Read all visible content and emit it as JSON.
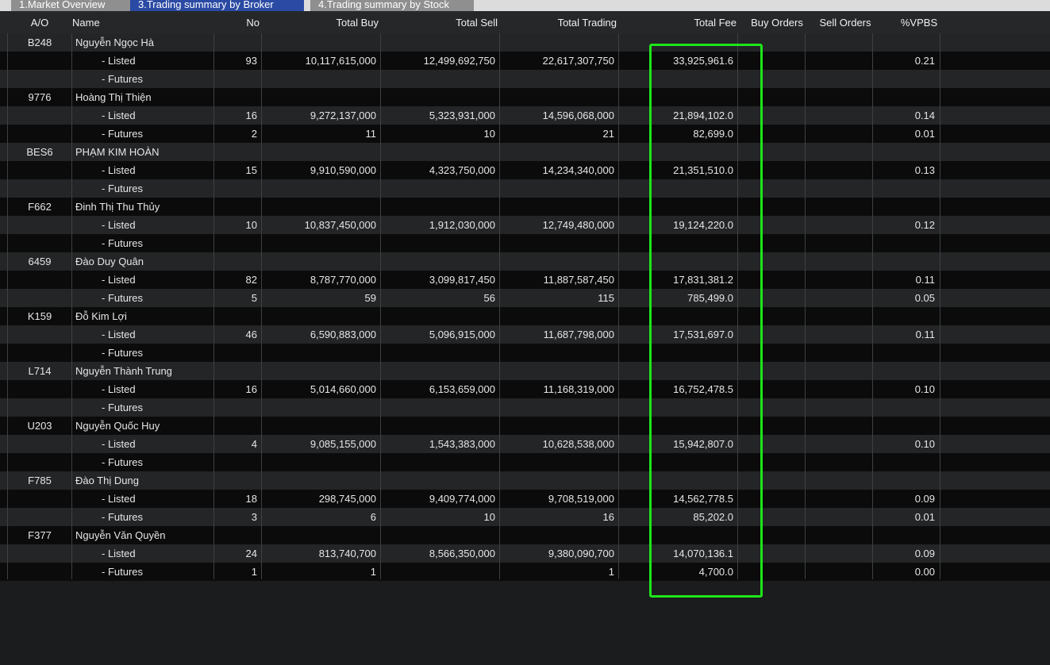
{
  "tabs": [
    {
      "label": "1.Market Overview",
      "active": false
    },
    {
      "label": "3.Trading summary by Broker",
      "active": true
    },
    {
      "label": "4.Trading summary by Stock",
      "active": false
    }
  ],
  "columns": [
    "A/O",
    "Name",
    "No",
    "Total Buy",
    "Total Sell",
    "Total Trading",
    "Total Fee",
    "Buy Orders",
    "Sell Orders",
    "%VPBS"
  ],
  "rows": [
    {
      "ao": "B248",
      "name": "Nguyễn Ngọc Hà",
      "no": "",
      "buy": "",
      "sell": "",
      "trading": "",
      "fee": "",
      "buy_orders": "",
      "sell_orders": "",
      "vpbs": ""
    },
    {
      "ao": "",
      "name": "- Listed",
      "no": "93",
      "buy": "10,117,615,000",
      "sell": "12,499,692,750",
      "trading": "22,617,307,750",
      "fee": "33,925,961.6",
      "buy_orders": "",
      "sell_orders": "",
      "vpbs": "0.21"
    },
    {
      "ao": "",
      "name": "- Futures",
      "no": "",
      "buy": "",
      "sell": "",
      "trading": "",
      "fee": "",
      "buy_orders": "",
      "sell_orders": "",
      "vpbs": ""
    },
    {
      "ao": "9776",
      "name": "Hoàng Thị Thiện",
      "no": "",
      "buy": "",
      "sell": "",
      "trading": "",
      "fee": "",
      "buy_orders": "",
      "sell_orders": "",
      "vpbs": ""
    },
    {
      "ao": "",
      "name": "- Listed",
      "no": "16",
      "buy": "9,272,137,000",
      "sell": "5,323,931,000",
      "trading": "14,596,068,000",
      "fee": "21,894,102.0",
      "buy_orders": "",
      "sell_orders": "",
      "vpbs": "0.14"
    },
    {
      "ao": "",
      "name": "- Futures",
      "no": "2",
      "buy": "11",
      "sell": "10",
      "trading": "21",
      "fee": "82,699.0",
      "buy_orders": "",
      "sell_orders": "",
      "vpbs": "0.01"
    },
    {
      "ao": "BES6",
      "name": "PHẠM KIM HOÀN",
      "no": "",
      "buy": "",
      "sell": "",
      "trading": "",
      "fee": "",
      "buy_orders": "",
      "sell_orders": "",
      "vpbs": ""
    },
    {
      "ao": "",
      "name": "- Listed",
      "no": "15",
      "buy": "9,910,590,000",
      "sell": "4,323,750,000",
      "trading": "14,234,340,000",
      "fee": "21,351,510.0",
      "buy_orders": "",
      "sell_orders": "",
      "vpbs": "0.13"
    },
    {
      "ao": "",
      "name": "- Futures",
      "no": "",
      "buy": "",
      "sell": "",
      "trading": "",
      "fee": "",
      "buy_orders": "",
      "sell_orders": "",
      "vpbs": ""
    },
    {
      "ao": "F662",
      "name": "Đinh Thị Thu Thủy",
      "no": "",
      "buy": "",
      "sell": "",
      "trading": "",
      "fee": "",
      "buy_orders": "",
      "sell_orders": "",
      "vpbs": ""
    },
    {
      "ao": "",
      "name": "- Listed",
      "no": "10",
      "buy": "10,837,450,000",
      "sell": "1,912,030,000",
      "trading": "12,749,480,000",
      "fee": "19,124,220.0",
      "buy_orders": "",
      "sell_orders": "",
      "vpbs": "0.12"
    },
    {
      "ao": "",
      "name": "- Futures",
      "no": "",
      "buy": "",
      "sell": "",
      "trading": "",
      "fee": "",
      "buy_orders": "",
      "sell_orders": "",
      "vpbs": ""
    },
    {
      "ao": "6459",
      "name": "Đào Duy Quân",
      "no": "",
      "buy": "",
      "sell": "",
      "trading": "",
      "fee": "",
      "buy_orders": "",
      "sell_orders": "",
      "vpbs": ""
    },
    {
      "ao": "",
      "name": "- Listed",
      "no": "82",
      "buy": "8,787,770,000",
      "sell": "3,099,817,450",
      "trading": "11,887,587,450",
      "fee": "17,831,381.2",
      "buy_orders": "",
      "sell_orders": "",
      "vpbs": "0.11"
    },
    {
      "ao": "",
      "name": "- Futures",
      "no": "5",
      "buy": "59",
      "sell": "56",
      "trading": "115",
      "fee": "785,499.0",
      "buy_orders": "",
      "sell_orders": "",
      "vpbs": "0.05"
    },
    {
      "ao": "K159",
      "name": "Đỗ Kim Lợi",
      "no": "",
      "buy": "",
      "sell": "",
      "trading": "",
      "fee": "",
      "buy_orders": "",
      "sell_orders": "",
      "vpbs": ""
    },
    {
      "ao": "",
      "name": "- Listed",
      "no": "46",
      "buy": "6,590,883,000",
      "sell": "5,096,915,000",
      "trading": "11,687,798,000",
      "fee": "17,531,697.0",
      "buy_orders": "",
      "sell_orders": "",
      "vpbs": "0.11"
    },
    {
      "ao": "",
      "name": "- Futures",
      "no": "",
      "buy": "",
      "sell": "",
      "trading": "",
      "fee": "",
      "buy_orders": "",
      "sell_orders": "",
      "vpbs": ""
    },
    {
      "ao": "L714",
      "name": "Nguyễn Thành Trung",
      "no": "",
      "buy": "",
      "sell": "",
      "trading": "",
      "fee": "",
      "buy_orders": "",
      "sell_orders": "",
      "vpbs": ""
    },
    {
      "ao": "",
      "name": "- Listed",
      "no": "16",
      "buy": "5,014,660,000",
      "sell": "6,153,659,000",
      "trading": "11,168,319,000",
      "fee": "16,752,478.5",
      "buy_orders": "",
      "sell_orders": "",
      "vpbs": "0.10"
    },
    {
      "ao": "",
      "name": "- Futures",
      "no": "",
      "buy": "",
      "sell": "",
      "trading": "",
      "fee": "",
      "buy_orders": "",
      "sell_orders": "",
      "vpbs": ""
    },
    {
      "ao": "U203",
      "name": "Nguyễn Quốc Huy",
      "no": "",
      "buy": "",
      "sell": "",
      "trading": "",
      "fee": "",
      "buy_orders": "",
      "sell_orders": "",
      "vpbs": ""
    },
    {
      "ao": "",
      "name": "- Listed",
      "no": "4",
      "buy": "9,085,155,000",
      "sell": "1,543,383,000",
      "trading": "10,628,538,000",
      "fee": "15,942,807.0",
      "buy_orders": "",
      "sell_orders": "",
      "vpbs": "0.10"
    },
    {
      "ao": "",
      "name": "- Futures",
      "no": "",
      "buy": "",
      "sell": "",
      "trading": "",
      "fee": "",
      "buy_orders": "",
      "sell_orders": "",
      "vpbs": ""
    },
    {
      "ao": "F785",
      "name": "Đào Thị Dung",
      "no": "",
      "buy": "",
      "sell": "",
      "trading": "",
      "fee": "",
      "buy_orders": "",
      "sell_orders": "",
      "vpbs": ""
    },
    {
      "ao": "",
      "name": "- Listed",
      "no": "18",
      "buy": "298,745,000",
      "sell": "9,409,774,000",
      "trading": "9,708,519,000",
      "fee": "14,562,778.5",
      "buy_orders": "",
      "sell_orders": "",
      "vpbs": "0.09"
    },
    {
      "ao": "",
      "name": "- Futures",
      "no": "3",
      "buy": "6",
      "sell": "10",
      "trading": "16",
      "fee": "85,202.0",
      "buy_orders": "",
      "sell_orders": "",
      "vpbs": "0.01"
    },
    {
      "ao": "F377",
      "name": "Nguyễn Văn Quyền",
      "no": "",
      "buy": "",
      "sell": "",
      "trading": "",
      "fee": "",
      "buy_orders": "",
      "sell_orders": "",
      "vpbs": ""
    },
    {
      "ao": "",
      "name": "- Listed",
      "no": "24",
      "buy": "813,740,700",
      "sell": "8,566,350,000",
      "trading": "9,380,090,700",
      "fee": "14,070,136.1",
      "buy_orders": "",
      "sell_orders": "",
      "vpbs": "0.09"
    },
    {
      "ao": "",
      "name": "- Futures",
      "no": "1",
      "buy": "1",
      "sell": "",
      "trading": "1",
      "fee": "4,700.0",
      "buy_orders": "",
      "sell_orders": "",
      "vpbs": "0.00"
    }
  ],
  "colors": {
    "highlight": "#1ee51a",
    "active_tab": "#2a4aa3"
  }
}
